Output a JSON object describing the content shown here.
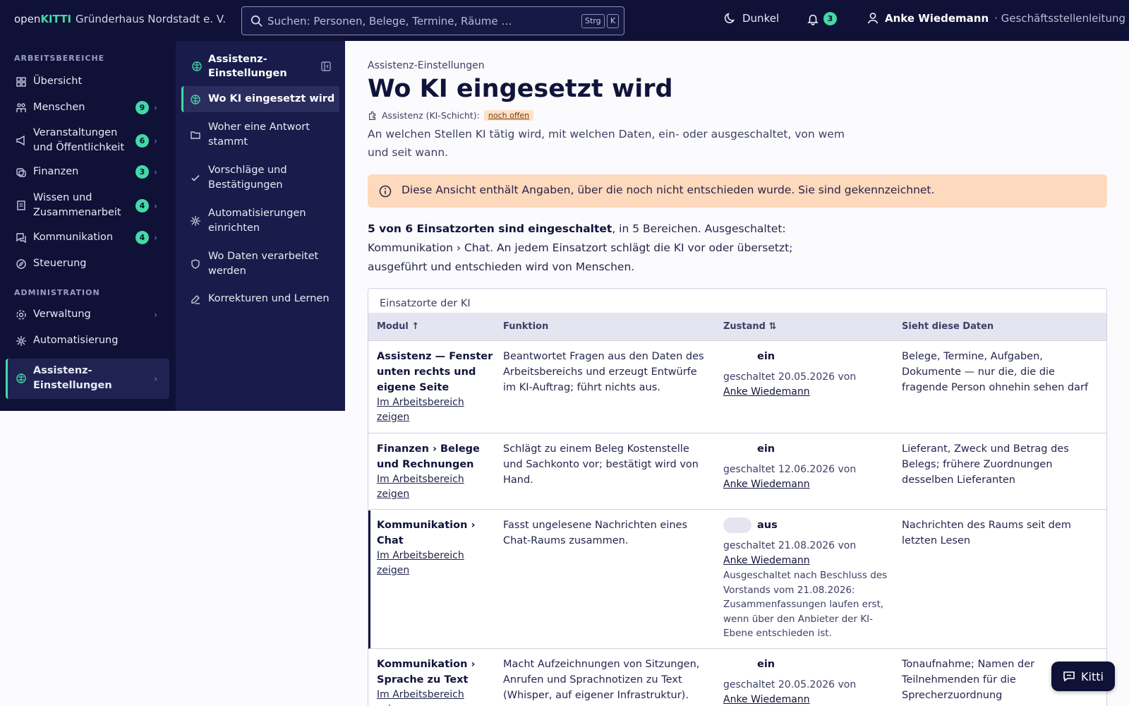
{
  "brand": {
    "part1": "open",
    "part2": "KITTI",
    "org": "Gründerhaus Nordstadt e. V."
  },
  "search": {
    "placeholder": "Suchen: Personen, Belege, Termine, Räume …",
    "kbd1": "Strg",
    "kbd2": "K"
  },
  "header": {
    "dark_label": "Dunkel",
    "notif_count": "3",
    "user_name": "Anke Wiedemann",
    "user_role": "· Geschäftsstellenleitung"
  },
  "sidebar": {
    "section1": "ARBEITSBEREICHE",
    "section2": "ADMINISTRATION",
    "items": [
      {
        "label": "Übersicht"
      },
      {
        "label": "Menschen",
        "count": "9"
      },
      {
        "label": "Veranstaltungen und Öffentlichkeit",
        "count": "6"
      },
      {
        "label": "Finanzen",
        "count": "3"
      },
      {
        "label": "Wissen und Zusammenarbeit",
        "count": "4"
      },
      {
        "label": "Kommunikation",
        "count": "4"
      },
      {
        "label": "Steuerung"
      }
    ],
    "admin_items": [
      {
        "label": "Verwaltung"
      },
      {
        "label": "Automatisierung"
      },
      {
        "label": "Assistenz-Einstellungen"
      }
    ]
  },
  "subpanel": {
    "title": "Assistenz-Einstellungen",
    "items": [
      {
        "label": "Wo KI eingesetzt wird"
      },
      {
        "label": "Woher eine Antwort stammt"
      },
      {
        "label": "Vorschläge und Bestätigungen"
      },
      {
        "label": "Automatisierungen einrichten"
      },
      {
        "label": "Wo Daten verarbeitet werden"
      },
      {
        "label": "Korrekturen und Lernen"
      }
    ]
  },
  "main": {
    "breadcrumb": "Assistenz-Einstellungen",
    "title": "Wo KI eingesetzt wird",
    "meta_label": "Assistenz (KI-Schicht):",
    "meta_pill": "noch offen",
    "intro": "An welchen Stellen KI tätig wird, mit welchen Daten, ein- oder ausgeschaltet, von wem und seit wann.",
    "notice": "Diese Ansicht enthält Angaben, über die noch nicht entschieden wurde. Sie sind gekennzeichnet.",
    "summary_bold": "5 von 6 Einsatzorten sind eingeschaltet",
    "summary_rest": ", in 5 Bereichen. Ausgeschaltet: Kommunikation › Chat. An jedem Einsatzort schlägt die KI vor oder übersetzt; ausgeführt und entschieden wird von Menschen."
  },
  "table": {
    "caption": "Einsatzorte der KI",
    "headers": {
      "modul": "Modul ↑",
      "funktion": "Funktion",
      "zustand": "Zustand ⇅",
      "daten": "Sieht diese Daten"
    },
    "link_label": "Im Arbeitsbereich zeigen",
    "switched_prefix": "geschaltet",
    "by": "von",
    "rows": [
      {
        "modul": "Assistenz — Fenster unten rechts und eigene Seite",
        "funktion": "Beantwortet Fragen aus den Daten des Arbeitsbereichs und erzeugt Entwürfe im KI-Auftrag; führt nichts aus.",
        "state": "ein",
        "date": "20.05.2026",
        "who": "Anke Wiedemann",
        "note": "",
        "daten": "Belege, Termine, Aufgaben, Dokumente — nur die, die die fragende Person ohnehin sehen darf"
      },
      {
        "modul": "Finanzen › Belege und Rechnungen",
        "funktion": "Schlägt zu einem Beleg Kostenstelle und Sachkonto vor; bestätigt wird von Hand.",
        "state": "ein",
        "date": "12.06.2026",
        "who": "Anke Wiedemann",
        "note": "",
        "daten": "Lieferant, Zweck und Betrag des Belegs; frühere Zuordnungen desselben Lieferanten"
      },
      {
        "modul": "Kommunikation › Chat",
        "funktion": "Fasst ungelesene Nachrichten eines Chat-Raums zusammen.",
        "state": "aus",
        "date": "21.08.2026",
        "who": "Anke Wiedemann",
        "note": "Ausgeschaltet nach Beschluss des Vorstands vom 21.08.2026: Zusammenfassungen laufen erst, wenn über den Anbieter der KI-Ebene entschieden ist.",
        "daten": "Nachrichten des Raums seit dem letzten Lesen"
      },
      {
        "modul": "Kommunikation › Sprache zu Text",
        "funktion": "Macht Aufzeichnungen von Sitzungen, Anrufen und Sprachnotizen zu Text (Whisper, auf eigener Infrastruktur).",
        "state": "ein",
        "date": "20.05.2026",
        "who": "Anke Wiedemann",
        "note": "",
        "daten": "Tonaufnahme; Namen der Teilnehmenden für die Sprecherzuordnung"
      }
    ]
  },
  "kitti_label": "Kitti",
  "colors": {
    "navy": "#0f1137",
    "accent": "#43d9a6",
    "notice": "#fdd9bd"
  }
}
